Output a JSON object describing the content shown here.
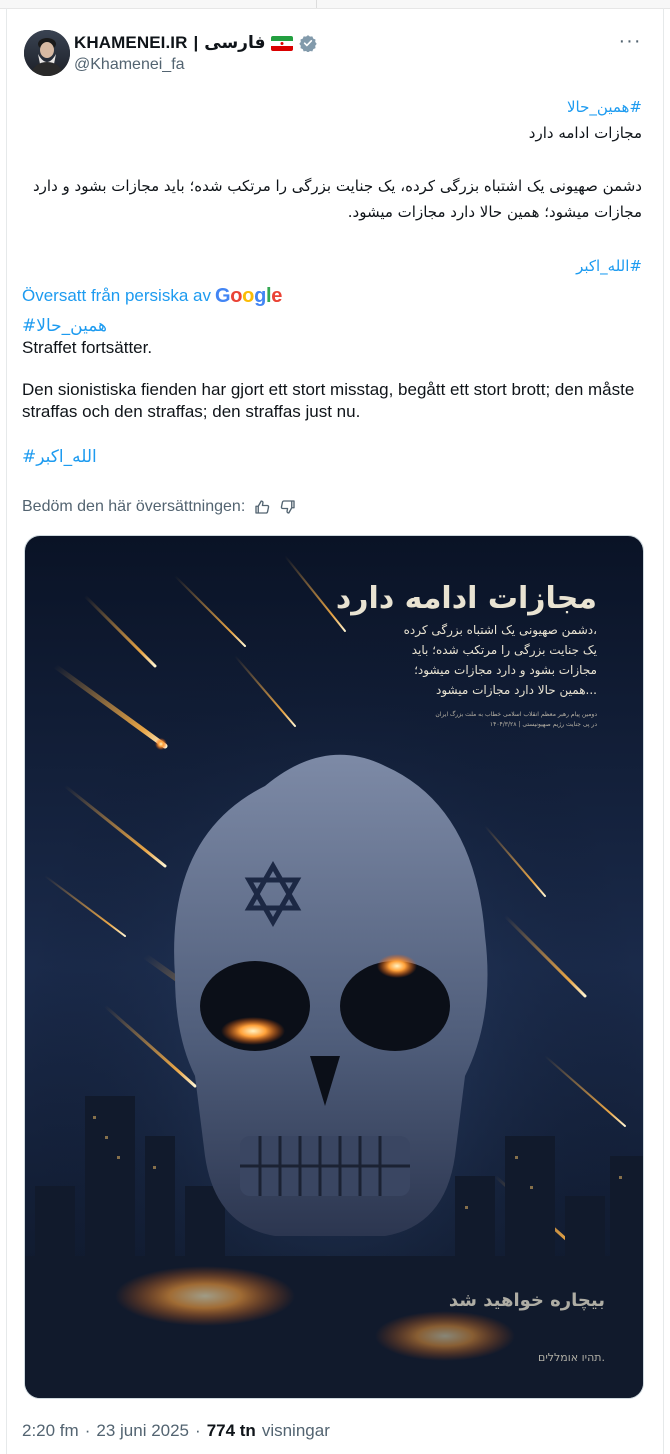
{
  "author": {
    "name": "KHAMENEI.IR",
    "separator": "|",
    "language_label": "فارسی",
    "flag_icon": "iran-flag-icon",
    "verified_icon": "verified-badge-icon",
    "handle": "@Khamenei_fa"
  },
  "post": {
    "more_label": "···",
    "original": {
      "hashtag_top": "#همین_حالا",
      "line1": "مجازات ادامه دارد",
      "paragraph": "دشمن صهیونی یک اشتباه بزرگی کرده، یک جنایت بزرگی را مرتکب شده؛ باید مجازات بشود و دارد مجازات میشود؛ همین حالا دارد مجازات میشود.",
      "hashtag_bottom": "#الله_اکبر"
    },
    "translation": {
      "label": "Översatt från persiska av",
      "provider": "Google",
      "hashtag_top": "#همین_حالا",
      "line1": "Straffet fortsätter.",
      "paragraph": "Den sionistiska fienden har gjort ett stort misstag, begått ett stort brott; den måste straffas och den straffas; den straffas just nu.",
      "hashtag_bottom": "#الله_اکبر",
      "rate_label": "Bedöm den här översättningen:"
    },
    "image": {
      "title": "مجازات ادامه دارد",
      "lines": [
        "دشمن صهیونی یک اشتباه بزرگی کرده،",
        "یک جنایت بزرگی را مرتکب شده؛ باید",
        "مجازات بشود و دارد مجازات میشود؛",
        "همین حالا دارد مجازات میشود..."
      ],
      "small_caption": "دومین پیام رهبر معظم انقلاب اسلامی خطاب به ملت بزرگ ایران",
      "small_caption2": "در پی جنایت رژیم صهیونیستی | ۱۴۰۴/۳/۲۸",
      "corner_text": "بیچاره خواهید شد",
      "hebrew_text": "תהיו אומללים."
    },
    "footer": {
      "time": "2:20 fm",
      "dot": "·",
      "date": "23 juni 2025",
      "dot2": "·",
      "views": "774 tn",
      "views_label": "visningar"
    }
  }
}
